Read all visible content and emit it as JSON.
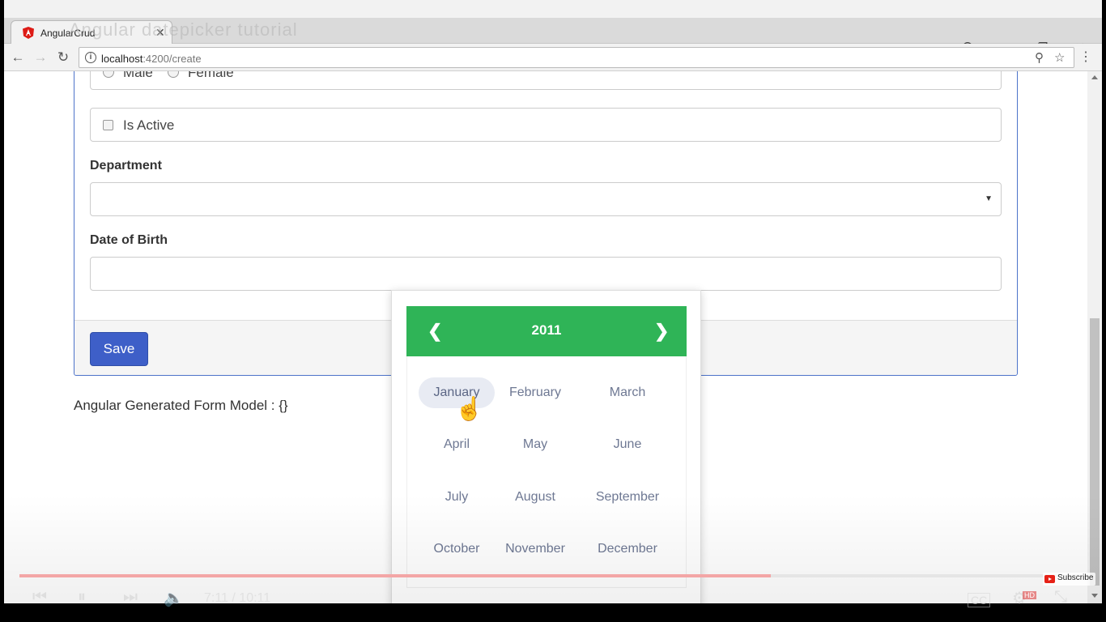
{
  "browser": {
    "tab_title": "AngularCrud",
    "tab_overlay_text": "Angular datepicker tutorial",
    "url_host": "localhost",
    "url_path": ":4200/create"
  },
  "form": {
    "gender_options": [
      "Male",
      "Female"
    ],
    "is_active_label": "Is Active",
    "department_label": "Department",
    "department_value": "",
    "dob_label": "Date of Birth",
    "dob_value": "",
    "save_label": "Save",
    "model_text": "Angular Generated Form Model : {}"
  },
  "datepicker": {
    "year": "2011",
    "prev_arrow": "❮",
    "next_arrow": "❯",
    "hovered_month": "January",
    "months": [
      "January",
      "February",
      "March",
      "April",
      "May",
      "June",
      "July",
      "August",
      "September",
      "October",
      "November",
      "December"
    ],
    "header_color": "#2fb457"
  },
  "video": {
    "time": "7:11 / 10:11",
    "progress": 0.71,
    "subscribe_label": "Subscribe",
    "hd_badge": "HD"
  }
}
